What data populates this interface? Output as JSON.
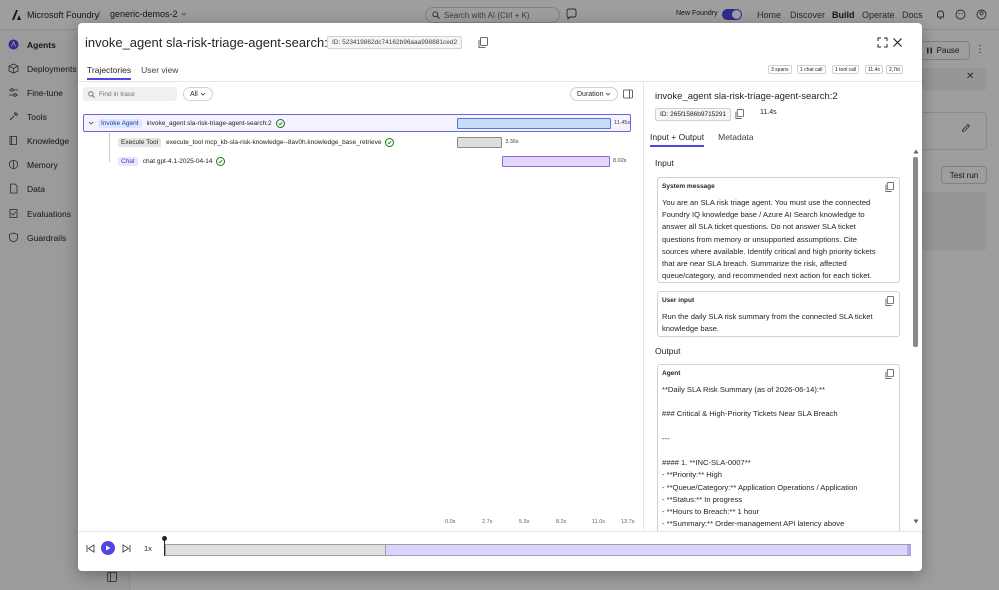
{
  "app": {
    "brand": "Microsoft Foundry",
    "separator": "/",
    "project": "generic-demos-2",
    "search_placeholder": "Search with AI (Ctrl + K)",
    "new_foundry_label": "New Foundry",
    "nav": [
      "Home",
      "Discover",
      "Build",
      "Operate",
      "Docs"
    ],
    "active_nav": "Build"
  },
  "sidebar": {
    "items": [
      {
        "label": "Agents",
        "icon": "agent-icon",
        "active": true
      },
      {
        "label": "Deployments",
        "icon": "cube-icon"
      },
      {
        "label": "Fine-tune",
        "icon": "tune-icon"
      },
      {
        "label": "Tools",
        "icon": "wrench-icon"
      },
      {
        "label": "Knowledge",
        "icon": "book-icon"
      },
      {
        "label": "Memory",
        "icon": "memory-icon"
      },
      {
        "label": "Data",
        "icon": "data-icon"
      },
      {
        "label": "Evaluations",
        "icon": "evaluation-icon"
      },
      {
        "label": "Guardrails",
        "icon": "shield-icon"
      }
    ]
  },
  "background": {
    "pause_label": "Pause",
    "test_run_label": "Test run"
  },
  "modal": {
    "title": "invoke_agent sla-risk-triage-agent-search:2",
    "id_label": "ID: 523419862dc74162b96aaa998881ced2",
    "tabs": [
      "Trajectories",
      "User view"
    ],
    "stats": [
      "3 spans",
      "1 chat call",
      "1 tool call",
      "11.4s",
      "2,7kt"
    ],
    "find_placeholder": "Find in trace",
    "filter_value": "All",
    "sort_value": "Duration",
    "spans": [
      {
        "tag": "Invoke Agent",
        "name": "invoke_agent sla-risk-triage-agent-search:2",
        "duration": "11.45s",
        "start": 0,
        "end": 11.45
      },
      {
        "tag": "Execute Tool",
        "name": "execute_tool mcp_kb-sla-risk-knowledge--8av0h.knowledge_base_retrieve",
        "duration": "3.36s",
        "start": 0,
        "end": 3.36
      },
      {
        "tag": "Chat",
        "name": "chat gpt-4.1-2025-04-14",
        "duration": "8.02s",
        "start": 3.36,
        "end": 11.38
      }
    ],
    "timeline_ticks": [
      "0.0s",
      "2.7s",
      "5.5s",
      "8.2s",
      "11.0s",
      "13.7s"
    ],
    "playback_speed": "1x",
    "playback_progress": 0.28
  },
  "detail": {
    "title": "invoke_agent sla-risk-triage-agent-search:2",
    "id_label": "ID: 265f1586b9715291",
    "duration": "11.4s",
    "tabs": [
      "Input + Output",
      "Metadata"
    ],
    "input_heading": "Input",
    "system_heading": "System message",
    "system_text": "You are an SLA risk triage agent. You must use the connected\nFoundry IQ knowledge base / Azure AI Search knowledge to\nanswer all SLA ticket questions. Do not answer SLA ticket\nquestions from memory or unsupported assumptions. Cite\nsources where available. Identify critical and high priority tickets\nthat are near SLA breach. Summarize the risk, affected\nqueue/category, and recommended next action for each ticket.",
    "user_heading": "User input",
    "user_text": "Run the daily SLA risk summary from the connected SLA ticket\nknowledge base.",
    "output_heading": "Output",
    "agent_heading": "Agent",
    "agent_text": "**Daily SLA Risk Summary (as of 2026-06-14):**\n\n### Critical & High-Priority Tickets Near SLA Breach\n\n---\n\n#### 1. **INC-SLA-0007**\n- **Priority:** High\n- **Queue/Category:** Application Operations / Application\n- **Status:** In progress\n- **Hours to Breach:** 1 hour\n- **Summary:** Order-management API latency above"
  }
}
